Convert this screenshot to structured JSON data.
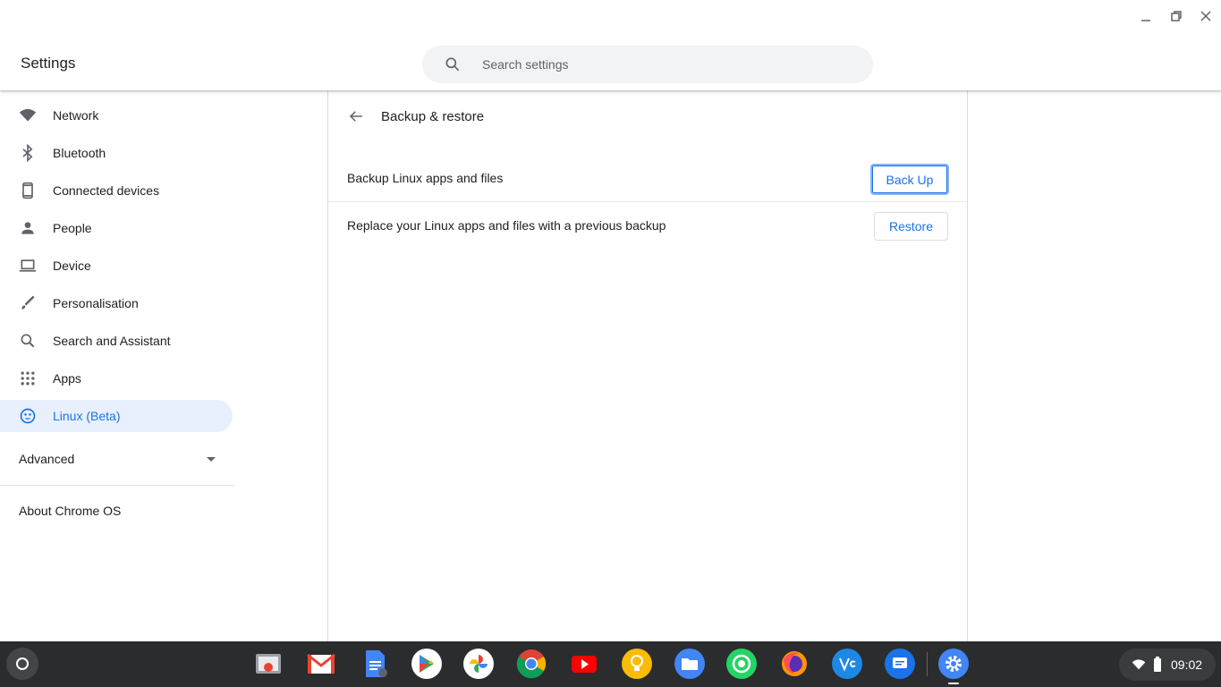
{
  "app": {
    "title": "Settings"
  },
  "search": {
    "placeholder": "Search settings"
  },
  "sidebar": {
    "items": [
      {
        "label": "Network",
        "icon": "wifi-icon"
      },
      {
        "label": "Bluetooth",
        "icon": "bluetooth-icon"
      },
      {
        "label": "Connected devices",
        "icon": "phone-icon"
      },
      {
        "label": "People",
        "icon": "person-icon"
      },
      {
        "label": "Device",
        "icon": "laptop-icon"
      },
      {
        "label": "Personalisation",
        "icon": "brush-icon"
      },
      {
        "label": "Search and Assistant",
        "icon": "search-icon"
      },
      {
        "label": "Apps",
        "icon": "apps-grid-icon"
      },
      {
        "label": "Linux (Beta)",
        "icon": "linux-penguin-icon",
        "active": true
      }
    ],
    "advanced_label": "Advanced",
    "about_label": "About Chrome OS"
  },
  "main": {
    "title": "Backup & restore",
    "rows": [
      {
        "text": "Backup Linux apps and files",
        "button": "Back Up"
      },
      {
        "text": "Replace your Linux apps and files with a previous backup",
        "button": "Restore"
      }
    ]
  },
  "shelf": {
    "apps": [
      "chrome-canvas-icon",
      "gmail-icon",
      "docs-icon",
      "play-store-icon",
      "photos-icon",
      "chrome-icon",
      "youtube-icon",
      "keep-icon",
      "files-icon",
      "whatsapp-icon",
      "firefox-icon",
      "vscode-icon",
      "messages-icon",
      "settings-icon"
    ],
    "time": "09:02"
  },
  "colors": {
    "accent": "#1a73e8",
    "active_bg": "#e8f0fe",
    "shelf_bg": "#2b2c2e"
  }
}
